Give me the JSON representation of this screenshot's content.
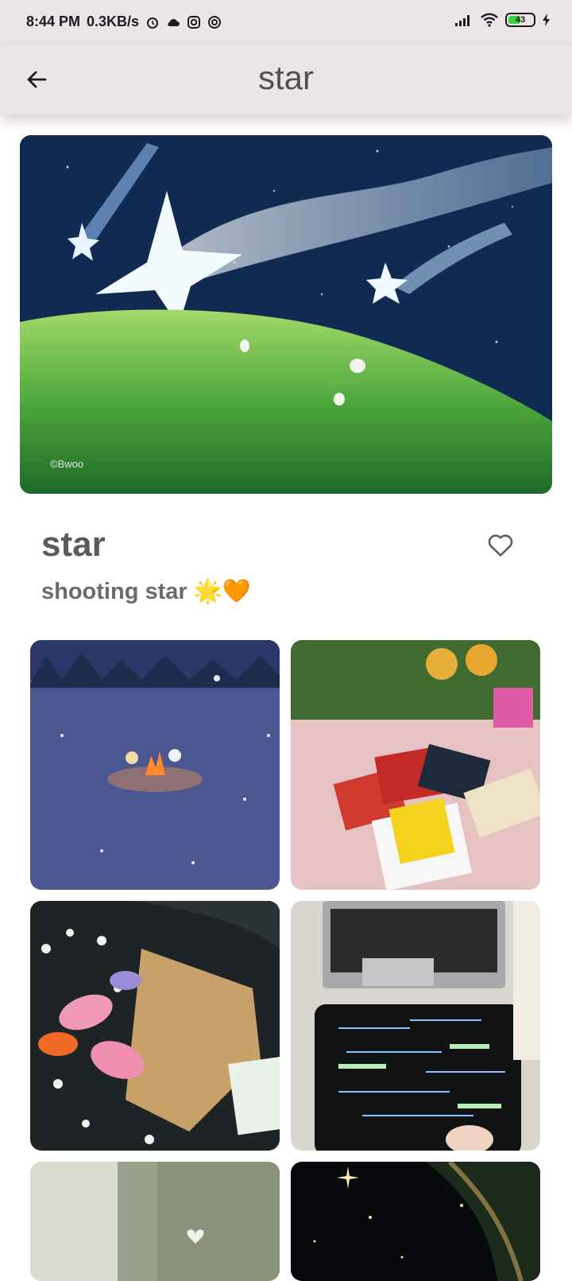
{
  "status_bar": {
    "time": "8:44 PM",
    "speed": "0.3KB/s",
    "battery": "43",
    "icons": [
      "alarm-icon",
      "cloud-icon",
      "instagram-icon",
      "circle-slash-icon",
      "signal-icon",
      "wifi-icon",
      "battery-icon",
      "charging-bolt-icon"
    ]
  },
  "app_bar": {
    "title": "star",
    "back_icon": "arrow-left-icon"
  },
  "pin": {
    "image": "shooting-star-illustration",
    "credit": "©Bwoo",
    "title": "star",
    "description": "shooting star 🌟🧡",
    "like_icon": "heart-outline-icon"
  },
  "related_pins": [
    {
      "image": "campfire-snow-illustration"
    },
    {
      "image": "picnic-games-photo"
    },
    {
      "image": "flower-bouquet-photo"
    },
    {
      "image": "laptop-tablet-notes-photo"
    },
    {
      "image": "window-curtain-photo"
    },
    {
      "image": "starry-sky-photo"
    }
  ],
  "colors": {
    "app_bar_bg": "#ebe5e9",
    "title_text": "#505050"
  }
}
